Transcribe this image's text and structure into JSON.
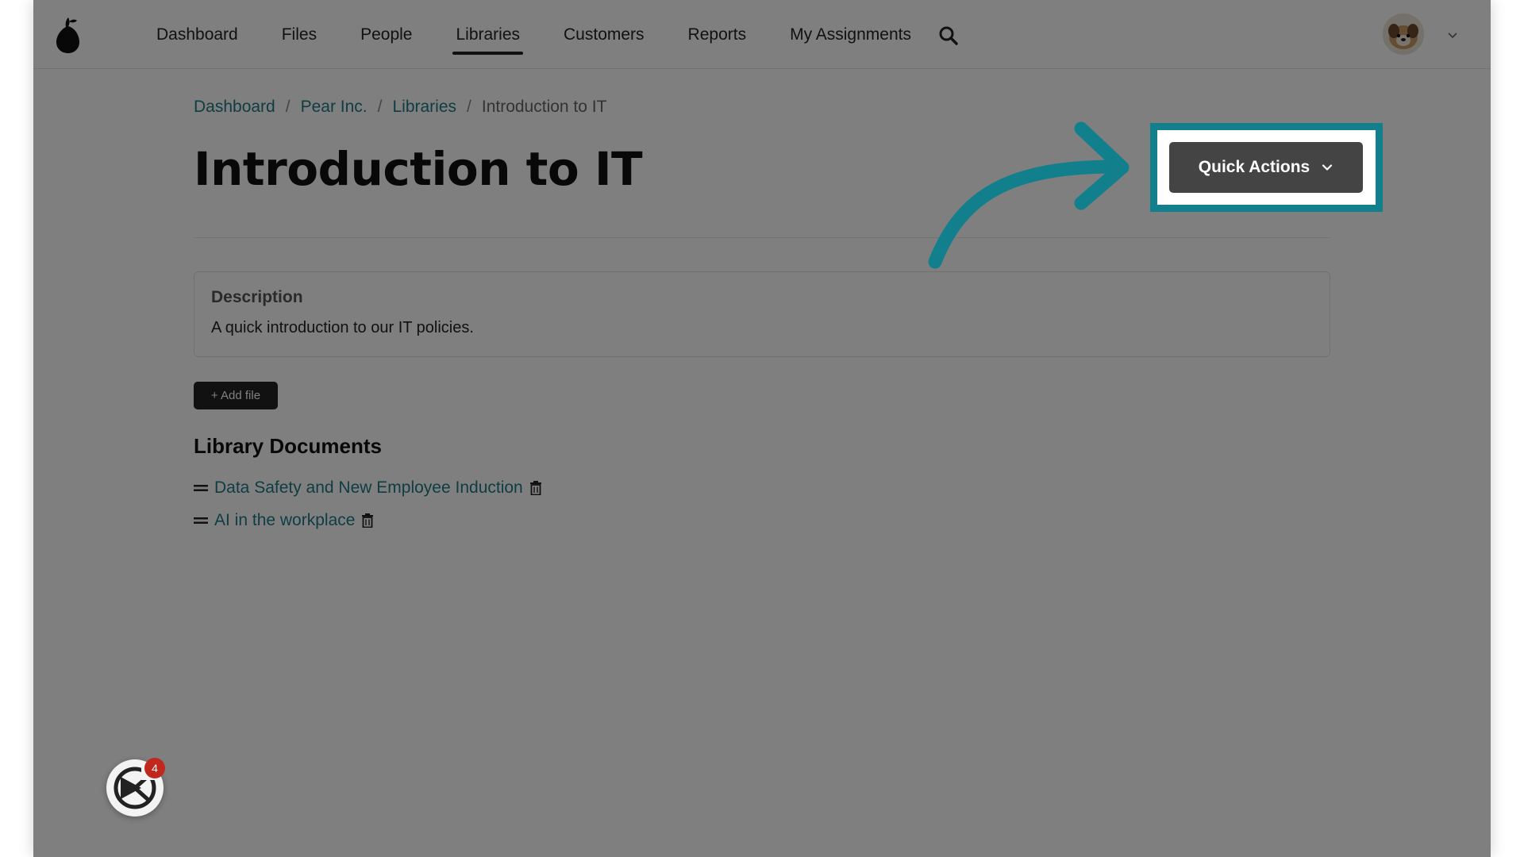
{
  "header": {
    "nav": [
      {
        "label": "Dashboard",
        "active": false
      },
      {
        "label": "Files",
        "active": false
      },
      {
        "label": "People",
        "active": false
      },
      {
        "label": "Libraries",
        "active": true
      },
      {
        "label": "Customers",
        "active": false
      },
      {
        "label": "Reports",
        "active": false
      },
      {
        "label": "My Assignments",
        "active": false
      }
    ],
    "icons": {
      "logo": "pear-logo-icon",
      "search": "search-icon",
      "avatar_chevron": "chevron-down-icon"
    }
  },
  "breadcrumb": {
    "items": [
      "Dashboard",
      "Pear Inc.",
      "Libraries"
    ],
    "separator": "/",
    "current": "Introduction to IT"
  },
  "page": {
    "title": "Introduction to IT",
    "quick_actions_label": "Quick Actions"
  },
  "description": {
    "title": "Description",
    "text": "A quick introduction to our IT policies."
  },
  "actions": {
    "add_file_label": "+ Add file"
  },
  "library_documents": {
    "title": "Library Documents",
    "items": [
      {
        "label": "Data Safety and New Employee Induction"
      },
      {
        "label": "AI in the workplace"
      }
    ]
  },
  "widget": {
    "badge_count": "4"
  },
  "colors": {
    "accent": "#127f8d",
    "link": "#1e7a86",
    "dark_button": "#444444",
    "badge": "#c0281e"
  }
}
